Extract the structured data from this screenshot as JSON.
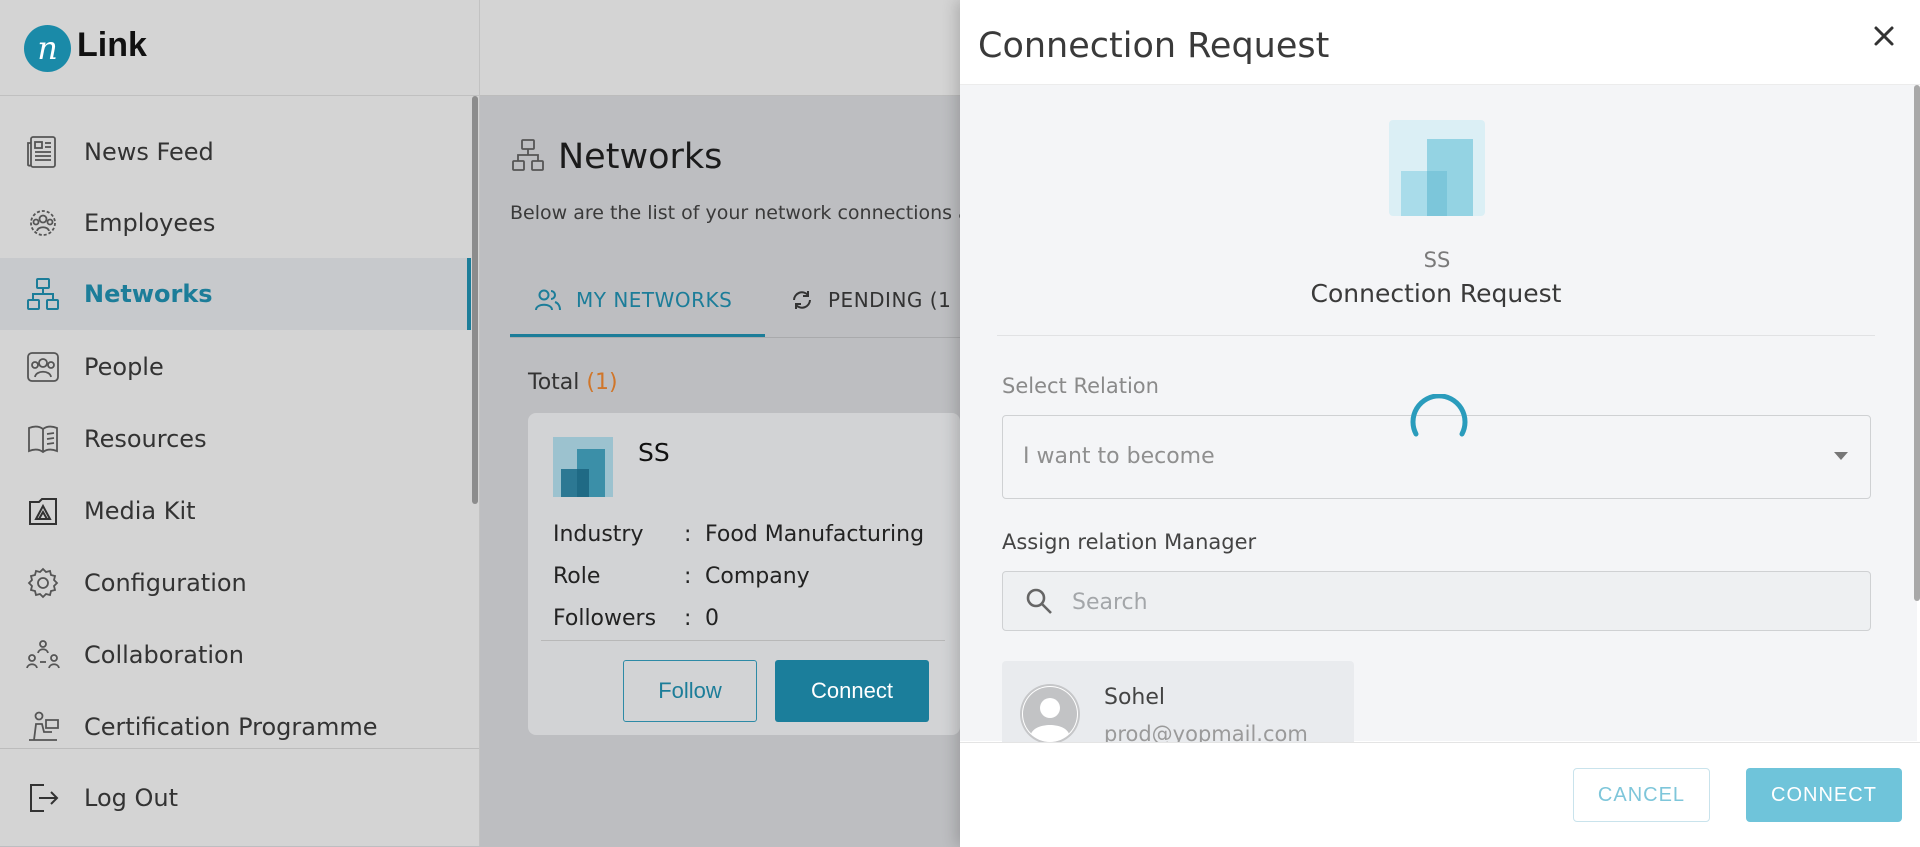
{
  "app": {
    "logo_letter": "n",
    "logo_text": "Link"
  },
  "sidebar": {
    "items": [
      {
        "label": "News Feed",
        "icon": "news-feed-icon"
      },
      {
        "label": "Employees",
        "icon": "employees-icon"
      },
      {
        "label": "Networks",
        "icon": "networks-icon",
        "active": true
      },
      {
        "label": "People",
        "icon": "people-icon"
      },
      {
        "label": "Resources",
        "icon": "resources-icon"
      },
      {
        "label": "Media Kit",
        "icon": "media-kit-icon"
      },
      {
        "label": "Configuration",
        "icon": "configuration-icon"
      },
      {
        "label": "Collaboration",
        "icon": "collaboration-icon"
      },
      {
        "label": "Certification Programme",
        "icon": "certification-icon"
      }
    ],
    "logout_label": "Log Out"
  },
  "main": {
    "title": "Networks",
    "description": "Below are the list of your network connections ar",
    "tabs": [
      {
        "label": "MY NETWORKS",
        "active": true
      },
      {
        "label": "PENDING (1"
      }
    ],
    "total_label": "Total",
    "total_count": "(1)",
    "card": {
      "name": "SS",
      "rows": [
        {
          "key": "Industry",
          "sep": ":",
          "value": "Food Manufacturing"
        },
        {
          "key": "Role",
          "sep": ":",
          "value": "Company"
        },
        {
          "key": "Followers",
          "sep": ":",
          "value": "0"
        }
      ],
      "follow_label": "Follow",
      "connect_label": "Connect"
    }
  },
  "drawer": {
    "title": "Connection Request",
    "company_short": "SS",
    "subtitle": "Connection Request",
    "select_relation_label": "Select Relation",
    "select_relation_value": "I want to become",
    "assign_manager_label": "Assign relation Manager",
    "search_placeholder": "Search",
    "user": {
      "name": "Sohel",
      "email": "prod@yopmail.com"
    },
    "cancel_label": "CANCEL",
    "connect_label": "CONNECT"
  },
  "colors": {
    "accent": "#1c7d99",
    "primary_button": "#1b7e9b",
    "connect_disabled": "#6fc4da",
    "total_count": "#d0762a"
  }
}
